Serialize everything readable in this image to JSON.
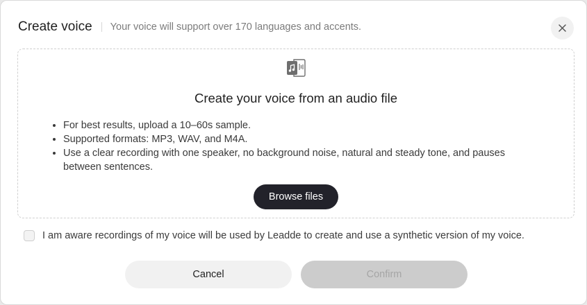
{
  "dialog": {
    "title": "Create voice",
    "subtitle": "Your voice will support over 170 languages and accents.",
    "close_icon": "close-icon"
  },
  "upload": {
    "icon": "audio-file-icon",
    "title": "Create your voice from an audio file",
    "tips": [
      "For best results, upload a 10–60s sample.",
      "Supported formats: MP3, WAV, and M4A.",
      "Use a clear recording with one speaker, no background noise, natural and steady tone, and pauses between sentences."
    ],
    "browse_label": "Browse files"
  },
  "consent": {
    "checked": false,
    "text": "I am aware recordings of my voice will be used by Leadde to create and use a synthetic version of my voice."
  },
  "actions": {
    "cancel_label": "Cancel",
    "confirm_label": "Confirm",
    "confirm_enabled": false
  },
  "colors": {
    "primary_button": "#22222a",
    "disabled_button": "#cccccc",
    "secondary_button": "#f1f1f1"
  }
}
